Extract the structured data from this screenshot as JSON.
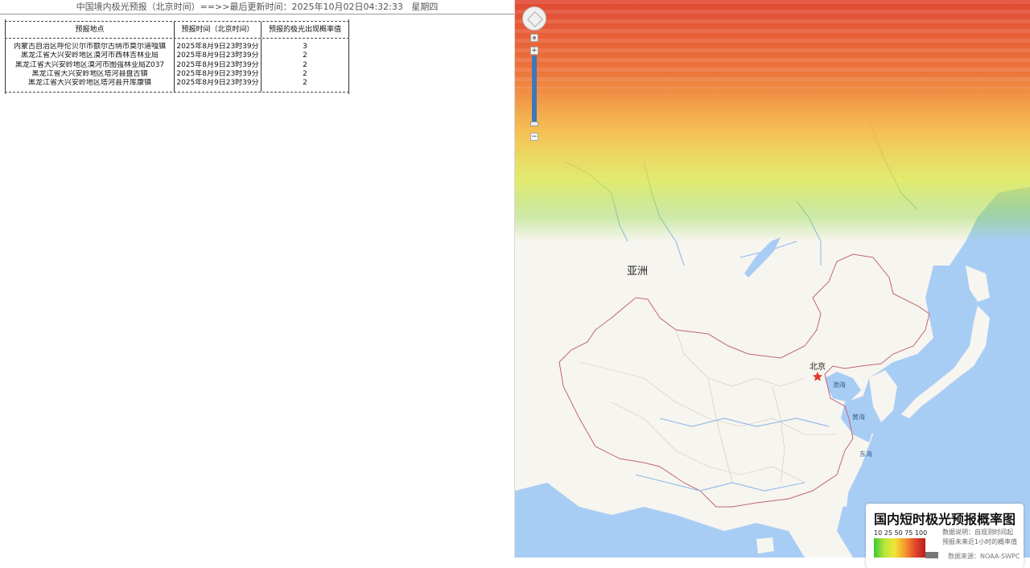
{
  "header": {
    "title": "中国境内极光预报（北京时间）==>>最后更新时间：2025年10月02日04:32:33",
    "weekday": "星期四"
  },
  "table": {
    "columns": [
      "预报地点",
      "预报时间（北京时间）",
      "预报的极光出现概率值"
    ],
    "rows": [
      {
        "location": "内蒙古自治区呼伦贝尔市额尔古纳市莫尔道嘎镇",
        "time": "2025年8月9日23时39分",
        "value": "3"
      },
      {
        "location": "黑龙江省大兴安岭地区漠河市西林吉林业局",
        "time": "2025年8月9日23时39分",
        "value": "2"
      },
      {
        "location": "黑龙江省大兴安岭地区漠河市图强林业局Z037",
        "time": "2025年8月9日23时39分",
        "value": "2"
      },
      {
        "location": "黑龙江省大兴安岭地区塔河县盘古镇",
        "time": "2025年8月9日23时39分",
        "value": "2"
      },
      {
        "location": "黑龙江省大兴安岭地区塔河县开库康镇",
        "time": "2025年8月9日23时39分",
        "value": "2"
      }
    ]
  },
  "map": {
    "labels": {
      "asia": "亚洲",
      "beijing": "北京",
      "bohai": "渤海",
      "yellow_sea": "黄海",
      "east_sea": "东海"
    },
    "controls": {
      "zoom_in": "+",
      "zoom_out": "−"
    },
    "colors": {
      "land": "#f7f5ef",
      "sea": "#a8cdf5",
      "border": "#c0657a",
      "aurora_high": "#e0402a",
      "aurora_low": "#86d63c",
      "capital_star": "#e03a2a"
    }
  },
  "legend": {
    "title": "国内短时极光预报概率图",
    "scale": "10  25  50  75  100",
    "note_line1": "数据说明：自观测时间起",
    "note_line2": "预报未来近1小时的概率值",
    "source": "数据来源：NOAA-SWPC"
  }
}
